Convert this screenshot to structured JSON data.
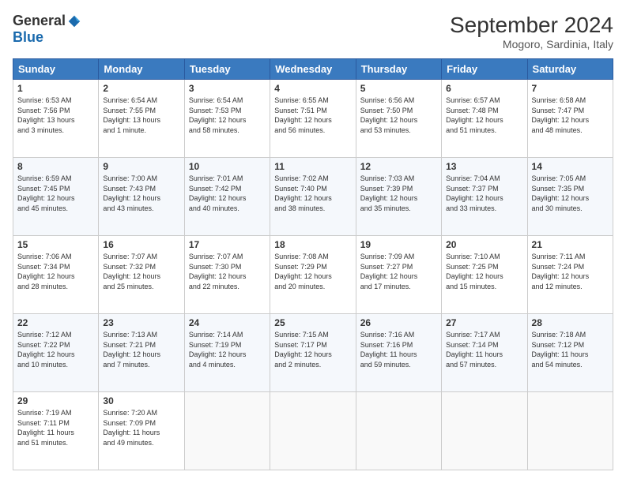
{
  "header": {
    "logo_general": "General",
    "logo_blue": "Blue",
    "month_title": "September 2024",
    "location": "Mogoro, Sardinia, Italy"
  },
  "days_of_week": [
    "Sunday",
    "Monday",
    "Tuesday",
    "Wednesday",
    "Thursday",
    "Friday",
    "Saturday"
  ],
  "weeks": [
    [
      {
        "day": "1",
        "info": "Sunrise: 6:53 AM\nSunset: 7:56 PM\nDaylight: 13 hours\nand 3 minutes."
      },
      {
        "day": "2",
        "info": "Sunrise: 6:54 AM\nSunset: 7:55 PM\nDaylight: 13 hours\nand 1 minute."
      },
      {
        "day": "3",
        "info": "Sunrise: 6:54 AM\nSunset: 7:53 PM\nDaylight: 12 hours\nand 58 minutes."
      },
      {
        "day": "4",
        "info": "Sunrise: 6:55 AM\nSunset: 7:51 PM\nDaylight: 12 hours\nand 56 minutes."
      },
      {
        "day": "5",
        "info": "Sunrise: 6:56 AM\nSunset: 7:50 PM\nDaylight: 12 hours\nand 53 minutes."
      },
      {
        "day": "6",
        "info": "Sunrise: 6:57 AM\nSunset: 7:48 PM\nDaylight: 12 hours\nand 51 minutes."
      },
      {
        "day": "7",
        "info": "Sunrise: 6:58 AM\nSunset: 7:47 PM\nDaylight: 12 hours\nand 48 minutes."
      }
    ],
    [
      {
        "day": "8",
        "info": "Sunrise: 6:59 AM\nSunset: 7:45 PM\nDaylight: 12 hours\nand 45 minutes."
      },
      {
        "day": "9",
        "info": "Sunrise: 7:00 AM\nSunset: 7:43 PM\nDaylight: 12 hours\nand 43 minutes."
      },
      {
        "day": "10",
        "info": "Sunrise: 7:01 AM\nSunset: 7:42 PM\nDaylight: 12 hours\nand 40 minutes."
      },
      {
        "day": "11",
        "info": "Sunrise: 7:02 AM\nSunset: 7:40 PM\nDaylight: 12 hours\nand 38 minutes."
      },
      {
        "day": "12",
        "info": "Sunrise: 7:03 AM\nSunset: 7:39 PM\nDaylight: 12 hours\nand 35 minutes."
      },
      {
        "day": "13",
        "info": "Sunrise: 7:04 AM\nSunset: 7:37 PM\nDaylight: 12 hours\nand 33 minutes."
      },
      {
        "day": "14",
        "info": "Sunrise: 7:05 AM\nSunset: 7:35 PM\nDaylight: 12 hours\nand 30 minutes."
      }
    ],
    [
      {
        "day": "15",
        "info": "Sunrise: 7:06 AM\nSunset: 7:34 PM\nDaylight: 12 hours\nand 28 minutes."
      },
      {
        "day": "16",
        "info": "Sunrise: 7:07 AM\nSunset: 7:32 PM\nDaylight: 12 hours\nand 25 minutes."
      },
      {
        "day": "17",
        "info": "Sunrise: 7:07 AM\nSunset: 7:30 PM\nDaylight: 12 hours\nand 22 minutes."
      },
      {
        "day": "18",
        "info": "Sunrise: 7:08 AM\nSunset: 7:29 PM\nDaylight: 12 hours\nand 20 minutes."
      },
      {
        "day": "19",
        "info": "Sunrise: 7:09 AM\nSunset: 7:27 PM\nDaylight: 12 hours\nand 17 minutes."
      },
      {
        "day": "20",
        "info": "Sunrise: 7:10 AM\nSunset: 7:25 PM\nDaylight: 12 hours\nand 15 minutes."
      },
      {
        "day": "21",
        "info": "Sunrise: 7:11 AM\nSunset: 7:24 PM\nDaylight: 12 hours\nand 12 minutes."
      }
    ],
    [
      {
        "day": "22",
        "info": "Sunrise: 7:12 AM\nSunset: 7:22 PM\nDaylight: 12 hours\nand 10 minutes."
      },
      {
        "day": "23",
        "info": "Sunrise: 7:13 AM\nSunset: 7:21 PM\nDaylight: 12 hours\nand 7 minutes."
      },
      {
        "day": "24",
        "info": "Sunrise: 7:14 AM\nSunset: 7:19 PM\nDaylight: 12 hours\nand 4 minutes."
      },
      {
        "day": "25",
        "info": "Sunrise: 7:15 AM\nSunset: 7:17 PM\nDaylight: 12 hours\nand 2 minutes."
      },
      {
        "day": "26",
        "info": "Sunrise: 7:16 AM\nSunset: 7:16 PM\nDaylight: 11 hours\nand 59 minutes."
      },
      {
        "day": "27",
        "info": "Sunrise: 7:17 AM\nSunset: 7:14 PM\nDaylight: 11 hours\nand 57 minutes."
      },
      {
        "day": "28",
        "info": "Sunrise: 7:18 AM\nSunset: 7:12 PM\nDaylight: 11 hours\nand 54 minutes."
      }
    ],
    [
      {
        "day": "29",
        "info": "Sunrise: 7:19 AM\nSunset: 7:11 PM\nDaylight: 11 hours\nand 51 minutes."
      },
      {
        "day": "30",
        "info": "Sunrise: 7:20 AM\nSunset: 7:09 PM\nDaylight: 11 hours\nand 49 minutes."
      },
      {
        "day": "",
        "info": ""
      },
      {
        "day": "",
        "info": ""
      },
      {
        "day": "",
        "info": ""
      },
      {
        "day": "",
        "info": ""
      },
      {
        "day": "",
        "info": ""
      }
    ]
  ]
}
